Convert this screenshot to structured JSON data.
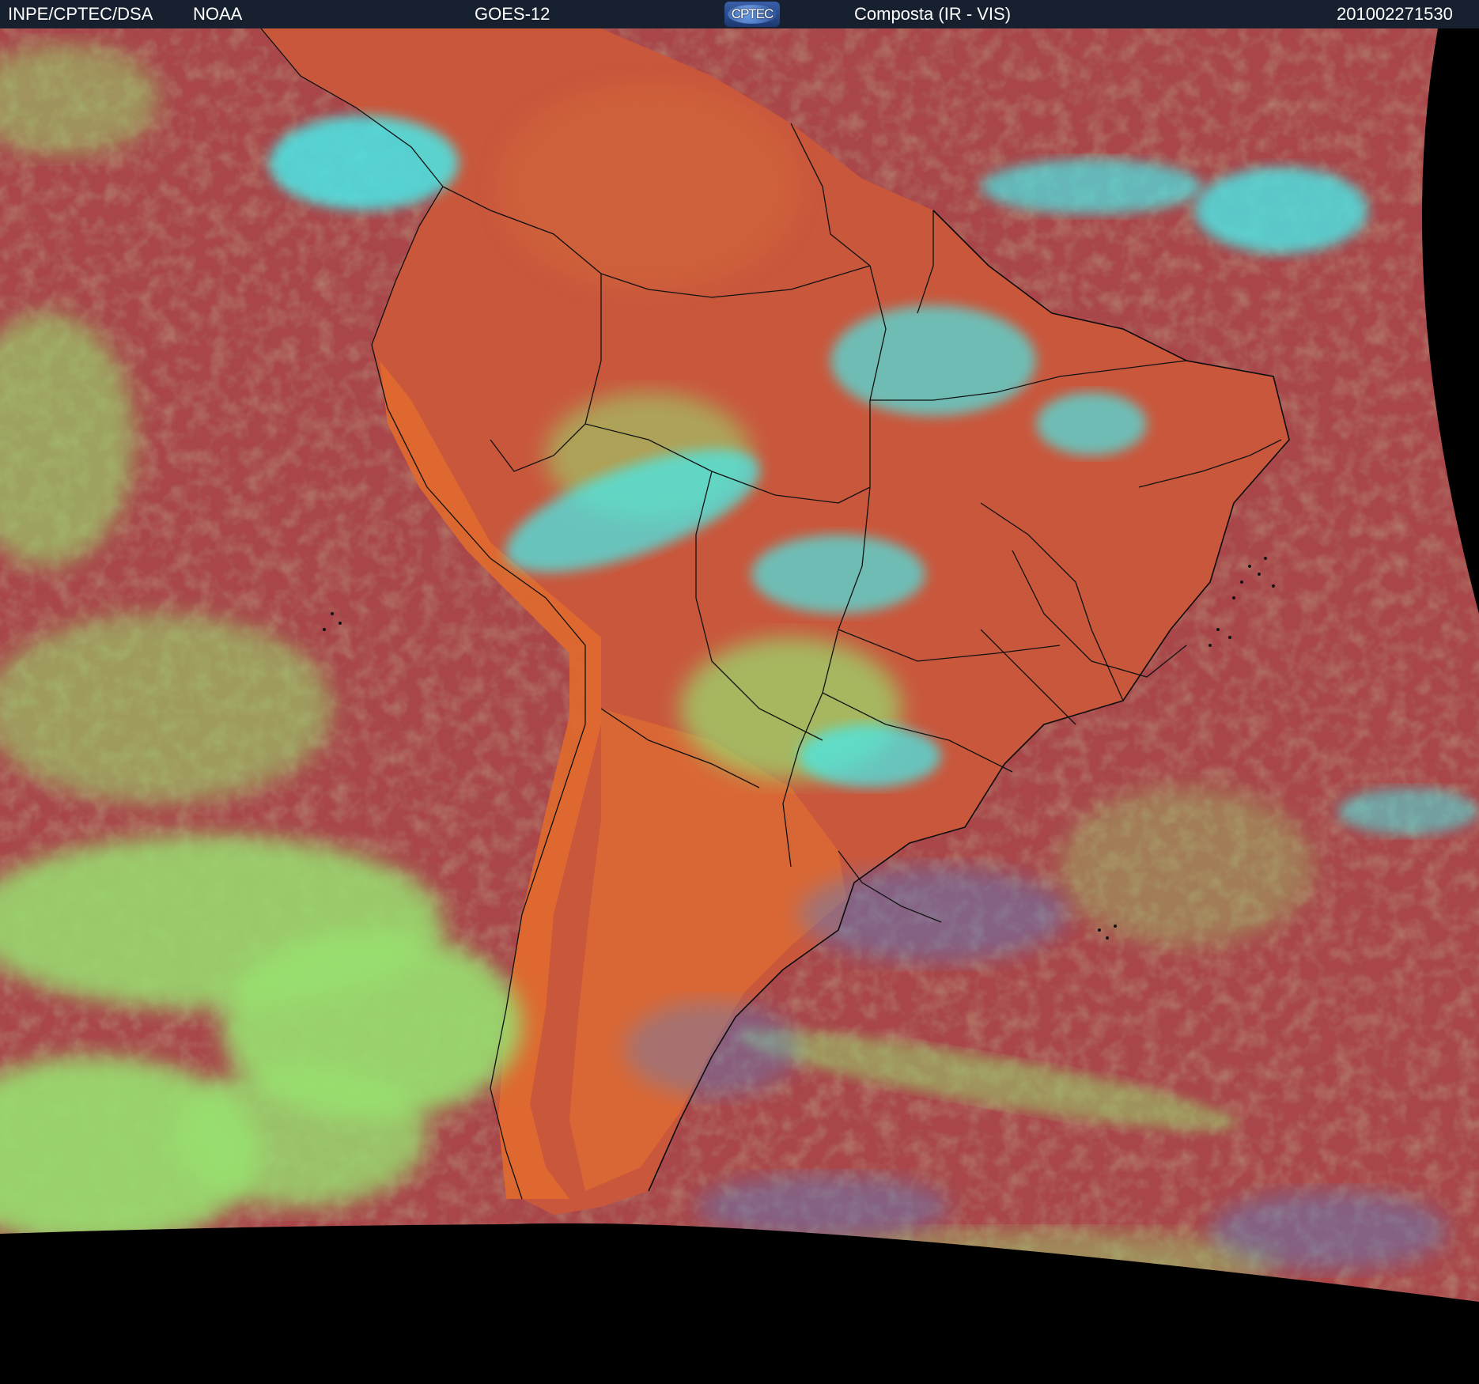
{
  "header": {
    "institution": "INPE/CPTEC/DSA",
    "agency": "NOAA",
    "satellite": "GOES-12",
    "logo_text": "CPTEC",
    "product": "Composta (IR - VIS)",
    "timestamp": "201002271530"
  },
  "palette": {
    "ocean": "#a8464a",
    "land_warm": "#d8603a",
    "low_cloud": "#98e070",
    "high_cloud": "#48e8e8",
    "mid_cloud": "#5c82c8",
    "background": "#000000",
    "header_bg": "#17202e"
  }
}
